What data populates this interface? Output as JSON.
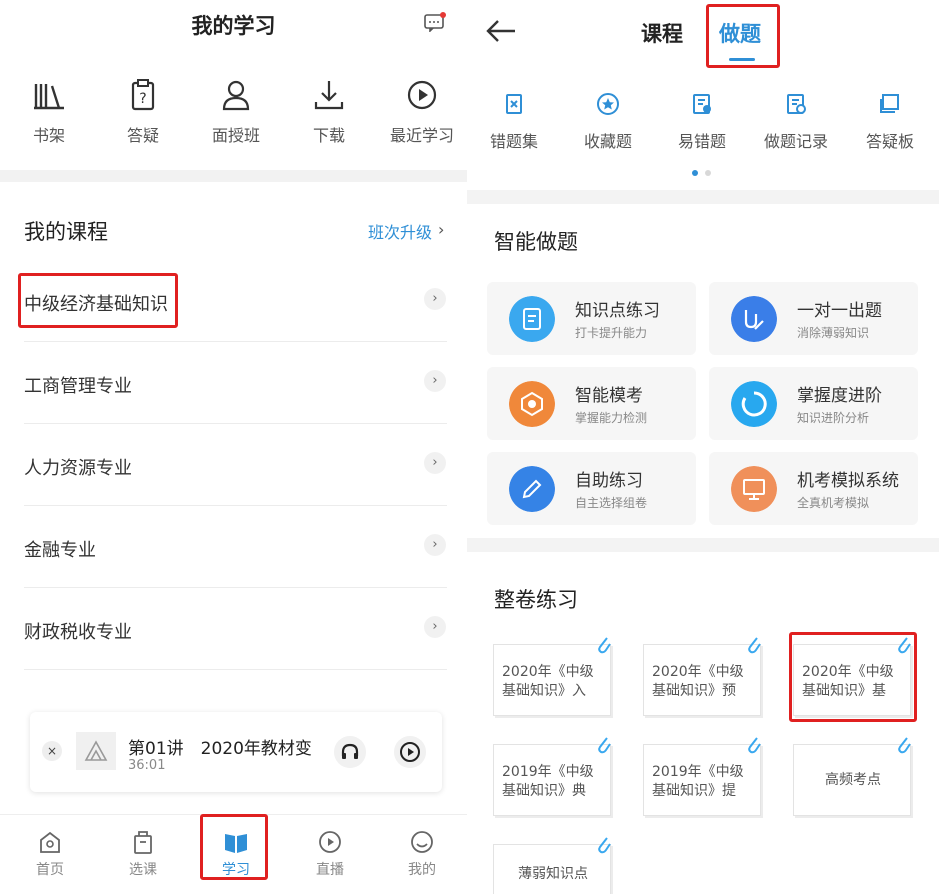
{
  "left": {
    "title": "我的学习",
    "quick_actions": [
      {
        "label": "书架",
        "icon": "bookshelf-icon"
      },
      {
        "label": "答疑",
        "icon": "clipboard-question-icon"
      },
      {
        "label": "面授班",
        "icon": "teacher-icon"
      },
      {
        "label": "下载",
        "icon": "download-icon"
      },
      {
        "label": "最近学习",
        "icon": "play-circle-icon"
      }
    ],
    "my_courses_title": "我的课程",
    "upgrade_label": "班次升级",
    "courses": [
      "中级经济基础知识",
      "工商管理专业",
      "人力资源专业",
      "金融专业",
      "财政税收专业"
    ],
    "player": {
      "title": "第01讲　2020年教材变",
      "time": "36:01"
    },
    "tabs": [
      {
        "label": "首页",
        "icon": "home-icon"
      },
      {
        "label": "选课",
        "icon": "bag-icon"
      },
      {
        "label": "学习",
        "icon": "book-open-icon",
        "active": true
      },
      {
        "label": "直播",
        "icon": "play-circle-icon"
      },
      {
        "label": "我的",
        "icon": "smile-icon"
      }
    ]
  },
  "right": {
    "tabs": {
      "course": "课程",
      "exercise": "做题"
    },
    "tools": [
      {
        "label": "错题集",
        "icon": "wrong-set-icon"
      },
      {
        "label": "收藏题",
        "icon": "star-circle-icon"
      },
      {
        "label": "易错题",
        "icon": "error-prone-icon"
      },
      {
        "label": "做题记录",
        "icon": "record-icon"
      },
      {
        "label": "答疑板",
        "icon": "board-icon"
      }
    ],
    "smart_title": "智能做题",
    "smart_cards": [
      {
        "title": "知识点练习",
        "subtitle": "打卡提升能力",
        "color": "#3aa8ef",
        "icon": "note-icon"
      },
      {
        "title": "一对一出题",
        "subtitle": "消除薄弱知识",
        "color": "#3a7ee8",
        "icon": "pen-user-icon"
      },
      {
        "title": "智能模考",
        "subtitle": "掌握能力检测",
        "color": "#f0883a",
        "icon": "exam-icon"
      },
      {
        "title": "掌握度进阶",
        "subtitle": "知识进阶分析",
        "color": "#28a8ef",
        "icon": "progress-ring-icon"
      },
      {
        "title": "自助练习",
        "subtitle": "自主选择组卷",
        "color": "#3583e6",
        "icon": "pencil-icon"
      },
      {
        "title": "机考模拟系统",
        "subtitle": "全真机考模拟",
        "color": "#f0905a",
        "icon": "monitor-icon"
      }
    ],
    "paper_title": "整卷练习",
    "papers": [
      "2020年《中级基础知识》入",
      "2020年《中级基础知识》预",
      "2020年《中级基础知识》基",
      "2019年《中级基础知识》典",
      "2019年《中级基础知识》提",
      "高频考点",
      "薄弱知识点"
    ]
  }
}
